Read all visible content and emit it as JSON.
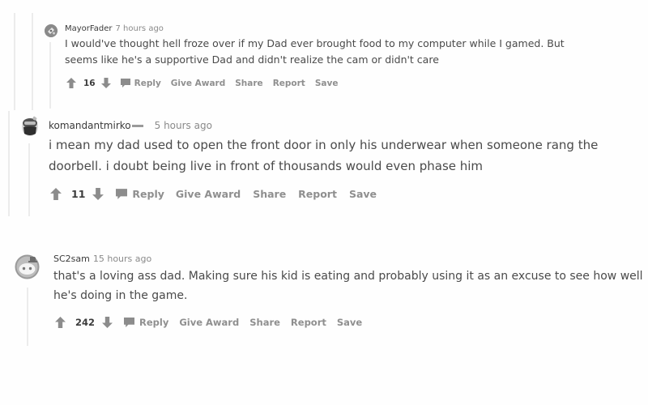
{
  "colors": {
    "text": "#4a4a4a",
    "meta": "#8a8a8a",
    "action": "#8f8f8f",
    "thread_line": "#ececec",
    "background": "#fefefe"
  },
  "comments": [
    {
      "author": "MayorFader",
      "time": "7 hours ago",
      "body": "I would've thought hell froze over if my Dad ever brought food to my computer while I gamed. But seems like he's a supportive Dad and didn't realize the cam or didn't care",
      "score": "16",
      "avatar_icon": "snoo-avatar-icon",
      "has_flair": false
    },
    {
      "author": "komandantmirko",
      "time": "5 hours ago",
      "body": "i mean my dad used to open the front door in only his underwear when someone rang the doorbell. i doubt being live in front of thousands would even phase him",
      "score": "11",
      "avatar_icon": "snoo-avatar-icon",
      "has_flair": true
    },
    {
      "author": "SC2sam",
      "time": "15 hours ago",
      "body": "that's a loving ass dad. Making sure his kid is eating and probably using it as an excuse to see how well he's doing in the game.",
      "score": "242",
      "avatar_icon": "snoo-avatar-icon",
      "has_flair": false
    }
  ],
  "actions": {
    "reply": "Reply",
    "give_award": "Give Award",
    "share": "Share",
    "report": "Report",
    "save": "Save"
  },
  "icons": {
    "upvote": "upvote-arrow-icon",
    "downvote": "downvote-arrow-icon",
    "reply": "speech-bubble-icon"
  }
}
